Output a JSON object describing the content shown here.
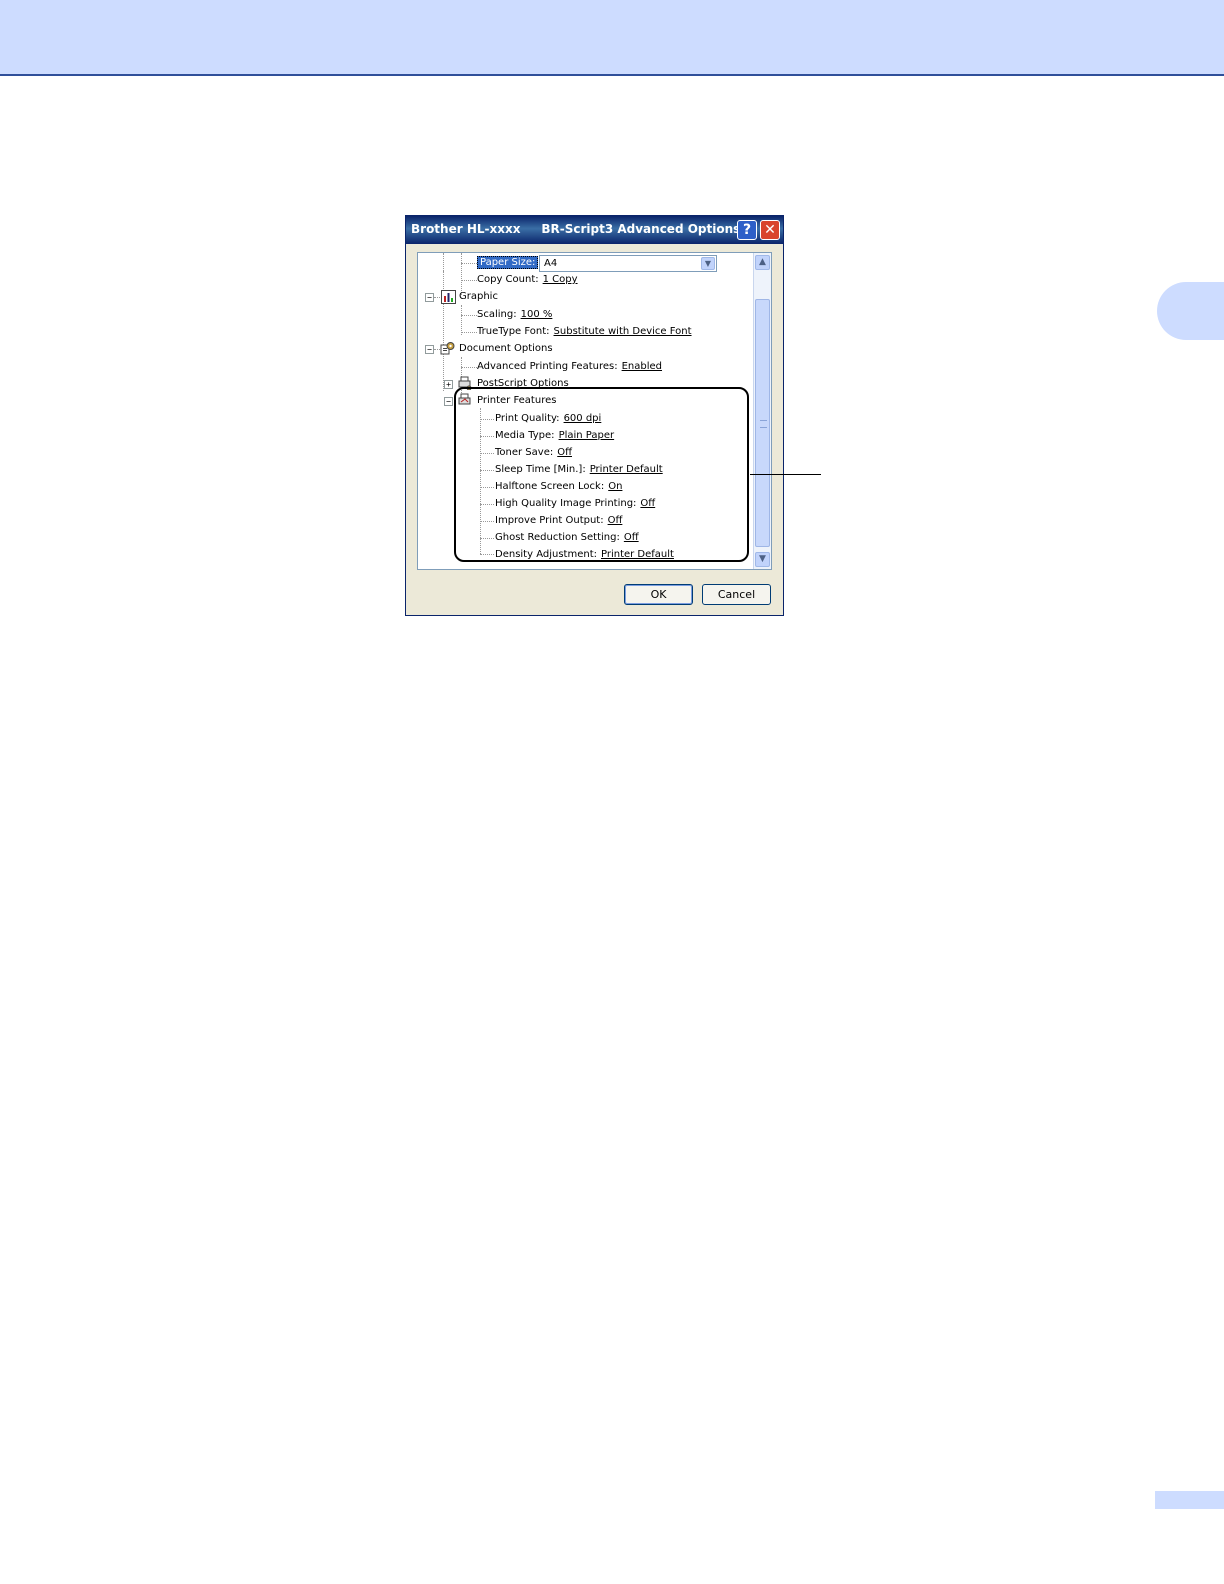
{
  "dialog": {
    "title": "Brother HL-xxxx     BR-Script3 Advanced Options",
    "help_label": "?",
    "close_label": "✕",
    "ok_label": "OK",
    "cancel_label": "Cancel"
  },
  "tree": {
    "paper_size": {
      "label": "Paper Size:",
      "value": "A4"
    },
    "copy_count": {
      "label": "Copy Count:",
      "value": "1 Copy"
    },
    "graphic": {
      "label": "Graphic"
    },
    "scaling": {
      "label": "Scaling:",
      "value": "100 %"
    },
    "truetype": {
      "label": "TrueType Font:",
      "value": "Substitute with Device Font"
    },
    "document_options": {
      "label": "Document Options"
    },
    "advanced_printing": {
      "label": "Advanced Printing Features:",
      "value": "Enabled"
    },
    "postscript": {
      "label": "PostScript Options"
    },
    "printer_features": {
      "label": "Printer Features"
    },
    "features": [
      {
        "label": "Print Quality:",
        "value": "600 dpi"
      },
      {
        "label": "Media Type:",
        "value": "Plain Paper"
      },
      {
        "label": "Toner Save:",
        "value": "Off"
      },
      {
        "label": "Sleep Time [Min.]:",
        "value": "Printer Default"
      },
      {
        "label": "Halftone Screen Lock:",
        "value": "On"
      },
      {
        "label": "High Quality Image Printing:",
        "value": "Off"
      },
      {
        "label": "Improve Print Output:",
        "value": "Off"
      },
      {
        "label": "Ghost Reduction Setting:",
        "value": "Off"
      },
      {
        "label": "Density Adjustment:",
        "value": "Printer Default"
      }
    ]
  },
  "icons": {
    "combo_arrow": "chevron-down-icon",
    "scroll_up": "scroll-up-icon",
    "scroll_down": "scroll-down-icon"
  },
  "colors": {
    "header_band": "#cddcff",
    "title_bar": "#0a246a",
    "selection": "#316ac5"
  }
}
